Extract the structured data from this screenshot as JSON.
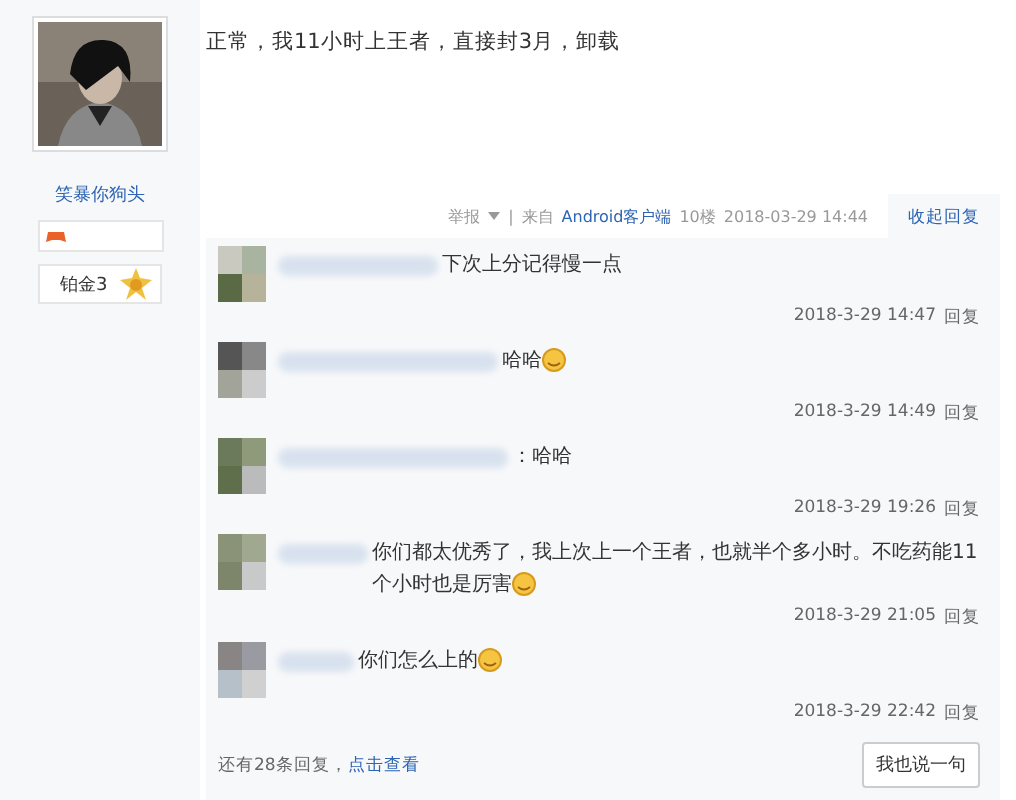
{
  "author": {
    "name": "笑暴你狗头",
    "rank": "铂金3"
  },
  "post": {
    "text": "正常，我11小时上王者，直接封3月，卸载"
  },
  "meta": {
    "report": "举报",
    "separator": "|",
    "source_prefix": "来自",
    "source": "Android客户端",
    "floor": "10楼",
    "time": "2018-03-29 14:44",
    "collapse": "收起回复"
  },
  "comments": [
    {
      "text": "下次上分记得慢一点",
      "emoji": false,
      "time": "2018-3-29 14:47",
      "reply": "回复"
    },
    {
      "text": "哈哈",
      "emoji": true,
      "time": "2018-3-29 14:49",
      "reply": "回复"
    },
    {
      "text": "：哈哈",
      "emoji": false,
      "time": "2018-3-29 19:26",
      "reply": "回复"
    },
    {
      "text": "你们都太优秀了，我上次上一个王者，也就半个多小时。不吃药能11个小时也是厉害",
      "emoji": true,
      "time": "2018-3-29 21:05",
      "reply": "回复"
    },
    {
      "text": "你们怎么上的",
      "emoji": true,
      "time": "2018-3-29 22:42",
      "reply": "回复"
    }
  ],
  "footer": {
    "more": "还有28条回复，",
    "more_link": "点击查看",
    "reply_button": "我也说一句"
  }
}
